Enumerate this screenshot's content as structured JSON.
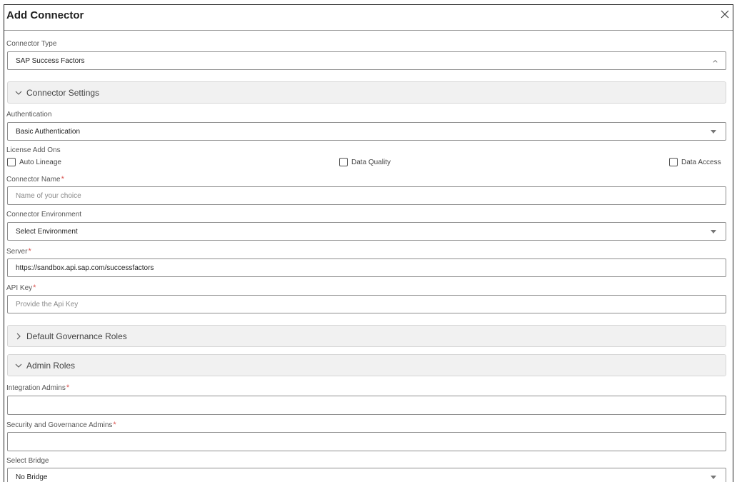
{
  "dialog": {
    "title": "Add Connector"
  },
  "connector_type": {
    "label": "Connector Type",
    "value": "SAP Success Factors"
  },
  "sections": {
    "connector_settings": "Connector Settings",
    "default_governance_roles": "Default Governance Roles",
    "admin_roles": "Admin Roles"
  },
  "authentication": {
    "label": "Authentication",
    "value": "Basic Authentication"
  },
  "license_add_ons": {
    "label": "License Add Ons",
    "options": [
      {
        "label": "Auto Lineage",
        "checked": false
      },
      {
        "label": "Data Quality",
        "checked": false
      },
      {
        "label": "Data Access",
        "checked": false
      }
    ]
  },
  "connector_name": {
    "label": "Connector Name",
    "required": "*",
    "placeholder": "Name of your choice"
  },
  "connector_environment": {
    "label": "Connector Environment",
    "value": "Select Environment"
  },
  "server": {
    "label": "Server",
    "required": "*",
    "value": "https://sandbox.api.sap.com/successfactors"
  },
  "api_key": {
    "label": "API Key",
    "required": "*",
    "placeholder": "Provide the Api Key"
  },
  "integration_admins": {
    "label": "Integration Admins",
    "required": "*",
    "value": ""
  },
  "security_governance_admins": {
    "label": "Security and Governance Admins",
    "required": "*",
    "value": ""
  },
  "select_bridge": {
    "label": "Select Bridge",
    "value": "No Bridge"
  },
  "icons": {
    "close": "close-icon",
    "expand": "chevron-down-icon",
    "collapse": "chevron-right-icon",
    "dropdown": "caret-down-icon"
  }
}
